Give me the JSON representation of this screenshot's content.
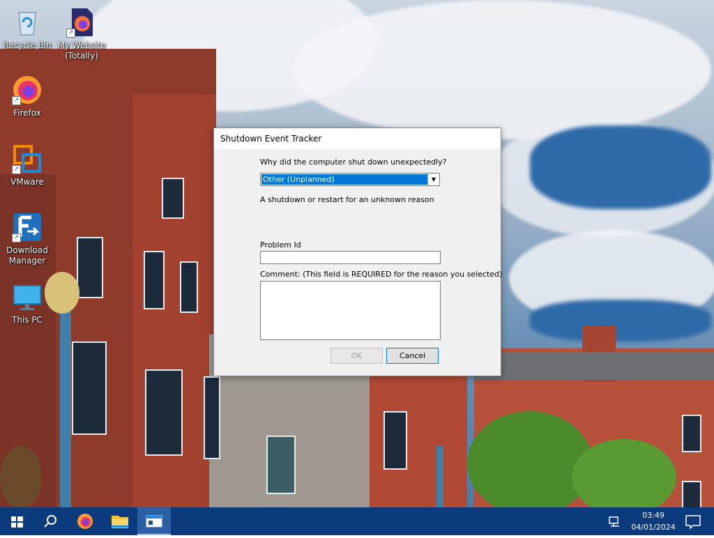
{
  "desktop": {
    "icons": [
      {
        "label": "Recycle Bin",
        "icon": "recycle-bin-icon"
      },
      {
        "label": "My Website (Totally)",
        "icon": "firefox-icon"
      },
      {
        "label": "Firefox",
        "icon": "firefox-icon"
      },
      {
        "label": "VMware",
        "icon": "vmware-icon"
      },
      {
        "label": "Download Manager",
        "icon": "download-manager-icon"
      },
      {
        "label": "This PC",
        "icon": "monitor-icon"
      }
    ]
  },
  "dialog": {
    "title": "Shutdown Event Tracker",
    "question": "Why did the computer shut down unexpectedly?",
    "reason_selected": "Other (Unplanned)",
    "reason_description": "A shutdown or restart for an unknown reason",
    "problem_id_label": "Problem Id",
    "problem_id_value": "",
    "comment_label": "Comment: (This field is REQUIRED for the reason you selected)",
    "comment_value": "",
    "ok_label": "OK",
    "cancel_label": "Cancel"
  },
  "taskbar": {
    "buttons": [
      "windows-start-icon",
      "search-icon",
      "firefox-icon",
      "file-explorer-icon",
      "shutdown-tracker-icon"
    ],
    "time": "03:49",
    "date": "04/01/2024",
    "colors": {
      "taskbar": "#0b3a7d",
      "accent": "#0078d7"
    }
  }
}
